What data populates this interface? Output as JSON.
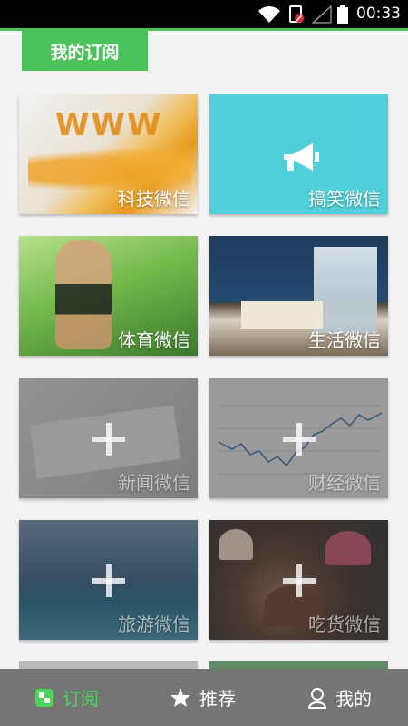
{
  "status_bar": {
    "time": "00:33",
    "icons": [
      "wifi-icon",
      "sim-blocked-icon",
      "signal-icon",
      "battery-icon"
    ]
  },
  "header": {
    "section_tab": "我的订阅",
    "accent_color": "#4cc35a"
  },
  "cards": [
    {
      "label": "科技微信",
      "subscribed": true
    },
    {
      "label": "搞笑微信",
      "subscribed": true,
      "icon": "megaphone-icon"
    },
    {
      "label": "体育微信",
      "subscribed": true
    },
    {
      "label": "生活微信",
      "subscribed": true
    },
    {
      "label": "新闻微信",
      "subscribed": false,
      "icon": "plus-icon"
    },
    {
      "label": "财经微信",
      "subscribed": false,
      "icon": "plus-icon"
    },
    {
      "label": "旅游微信",
      "subscribed": false,
      "icon": "plus-icon"
    },
    {
      "label": "吃货微信",
      "subscribed": false,
      "icon": "plus-icon"
    }
  ],
  "bottom_nav": {
    "tabs": [
      {
        "label": "订阅",
        "icon": "subscription-icon",
        "active": true
      },
      {
        "label": "推荐",
        "icon": "star-icon",
        "active": false
      },
      {
        "label": "我的",
        "icon": "person-icon",
        "active": false
      }
    ]
  }
}
